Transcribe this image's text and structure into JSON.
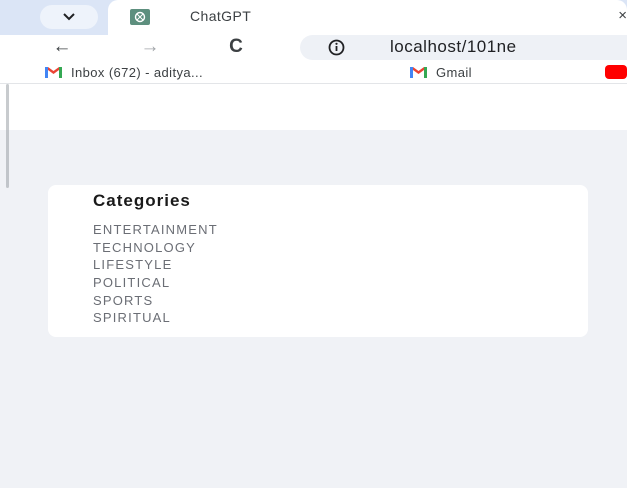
{
  "browser": {
    "tab": {
      "title": "ChatGPT",
      "close_symbol": "×"
    },
    "toolbar": {
      "back_symbol": "←",
      "forward_symbol": "→",
      "reload_symbol": "C",
      "url": "localhost/101ne"
    },
    "bookmarks": [
      {
        "label": "Inbox (672) - aditya...",
        "icon": "gmail-icon"
      },
      {
        "label": "Gmail",
        "icon": "gmail-icon"
      },
      {
        "label": "",
        "icon": "youtube-icon"
      }
    ]
  },
  "categories": {
    "title": "Categories",
    "items": [
      {
        "label": "ENTERTAINMENT"
      },
      {
        "label": "TECHNOLOGY"
      },
      {
        "label": "LIFESTYLE"
      },
      {
        "label": "POLITICAL"
      },
      {
        "label": "SPORTS"
      },
      {
        "label": "SPIRITUAL"
      }
    ]
  },
  "colors": {
    "tabbar_bg": "#dbe5f6",
    "page_bg": "#f0f2f6",
    "gmail_red": "#ea4335",
    "youtube_red": "#ff0000"
  }
}
